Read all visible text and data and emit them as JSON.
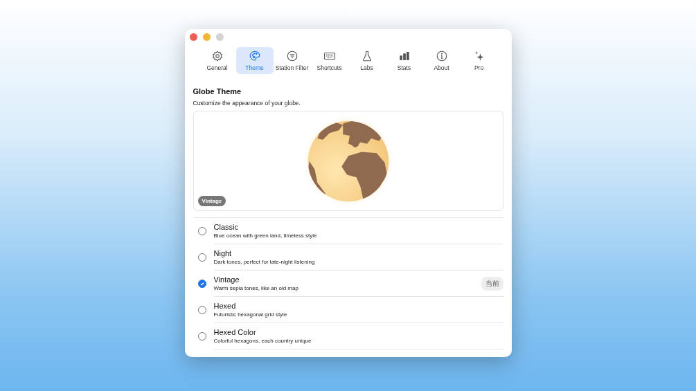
{
  "tabs": [
    {
      "label": "General",
      "selected": false
    },
    {
      "label": "Theme",
      "selected": true
    },
    {
      "label": "Station Filter",
      "selected": false
    },
    {
      "label": "Shortcuts",
      "selected": false
    },
    {
      "label": "Labs",
      "selected": false
    },
    {
      "label": "Stats",
      "selected": false
    },
    {
      "label": "About",
      "selected": false
    },
    {
      "label": "Pro",
      "selected": false
    }
  ],
  "section": {
    "title": "Globe Theme",
    "subtitle": "Customize the appearance of your globe."
  },
  "preview": {
    "kind": "picture",
    "badge": "Vintage"
  },
  "themes": [
    {
      "name": "Classic",
      "description": "Blue ocean with green land, timeless style",
      "selected": false
    },
    {
      "name": "Night",
      "description": "Dark tones, perfect for late-night listening",
      "selected": false
    },
    {
      "name": "Vintage",
      "description": "Warm sepia tones, like an old map",
      "selected": true,
      "badge": "当前"
    },
    {
      "name": "Hexed",
      "description": "Futuristic hexagonal grid style",
      "selected": false
    },
    {
      "name": "Hexed Color",
      "description": "Colorful hexagons, each country unique",
      "selected": false
    }
  ]
}
